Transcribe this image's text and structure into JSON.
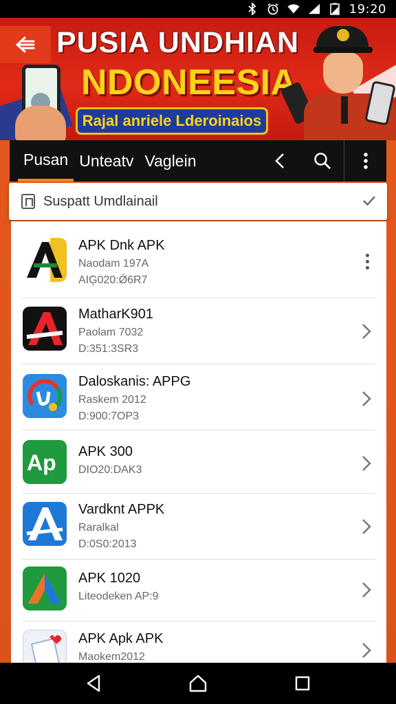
{
  "status_bar": {
    "time": "19:20",
    "icons": [
      "bluetooth-icon",
      "alarm-icon",
      "wifi-icon",
      "cell-signal-icon",
      "battery-icon"
    ]
  },
  "banner": {
    "title_line1": "PUSIA UNDHIAN",
    "title_line2": "NDONEESIA",
    "subtitle": "Rajal anriele Lderoinaios"
  },
  "tabs": [
    {
      "label": "Pusan",
      "active": true
    },
    {
      "label": "Unteatv",
      "active": false
    },
    {
      "label": "Vaglein",
      "active": false
    }
  ],
  "search": {
    "text": "Suspatt Umdlainail"
  },
  "apps": [
    {
      "title": "APK Dnk APK",
      "sub": "Naodam 197A",
      "sub2": "AIĢ020:Ǿ6R7",
      "action": "more"
    },
    {
      "title": "MatharK901",
      "sub": "Paolam 7032",
      "sub2": "D:351:3SR3",
      "action": "chevron"
    },
    {
      "title": "Daloskanis: APPG",
      "sub": "Raskem 2012",
      "sub2": "D:900:7OP3",
      "action": "chevron"
    },
    {
      "title": "APK 300",
      "sub": "DIO20:DAK3",
      "sub2": "",
      "action": "chevron"
    },
    {
      "title": "Vardknt APPK",
      "sub": "Raralkal",
      "sub2": "D:0S0:2013",
      "action": "chevron"
    },
    {
      "title": "APK 1020",
      "sub": "Liteodeken AP:9",
      "sub2": "",
      "action": "chevron"
    },
    {
      "title": "APK Apk APK",
      "sub": "Maokem2012",
      "sub2": "",
      "action": "chevron"
    }
  ],
  "colors": {
    "background": "#e8591c",
    "banner_red": "#d8231a",
    "banner_yellow": "#ffd21c",
    "tab_bar": "#111111",
    "tab_indicator": "#f08a1e"
  }
}
